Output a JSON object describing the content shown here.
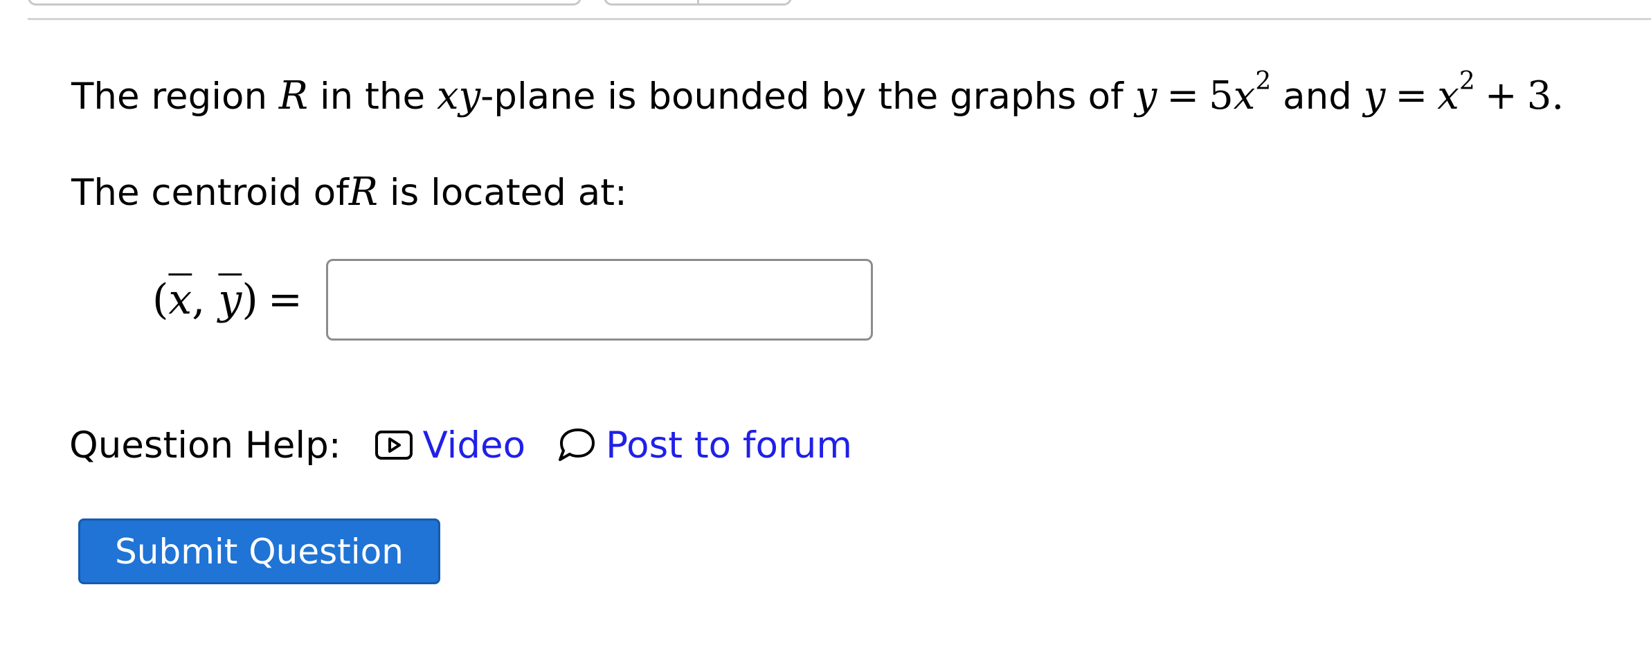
{
  "question": {
    "intro_prefix": "The region",
    "region_symbol": "R",
    "intro_middle": "in the",
    "plane_symbol": "xy",
    "intro_suffix": "-plane is bounded by the graphs of",
    "curve1": {
      "lhs": "y",
      "eq": "=",
      "coef": "5",
      "var": "x",
      "exp": "2"
    },
    "joiner": "and",
    "curve2": {
      "lhs": "y",
      "eq": "=",
      "var": "x",
      "exp": "2",
      "plus": "+",
      "const": "3",
      "end": "."
    },
    "centroid_prefix": "The centroid of",
    "centroid_symbol": "R",
    "centroid_suffix": "is located at:",
    "answer": {
      "open": "(",
      "xbar": "x",
      "comma": ",",
      "ybar": "y",
      "close": ")",
      "eq": "=",
      "value": "",
      "placeholder": ""
    }
  },
  "help": {
    "label": "Question Help:",
    "video_label": "Video",
    "forum_label": "Post to forum",
    "video_icon": "video-icon",
    "forum_icon": "speech-bubble-icon"
  },
  "submit": {
    "label": "Submit Question"
  },
  "colors": {
    "link": "#2020e8",
    "button_bg": "#1f74d6",
    "button_text": "#ffffff",
    "input_border": "#8c8c8c"
  }
}
